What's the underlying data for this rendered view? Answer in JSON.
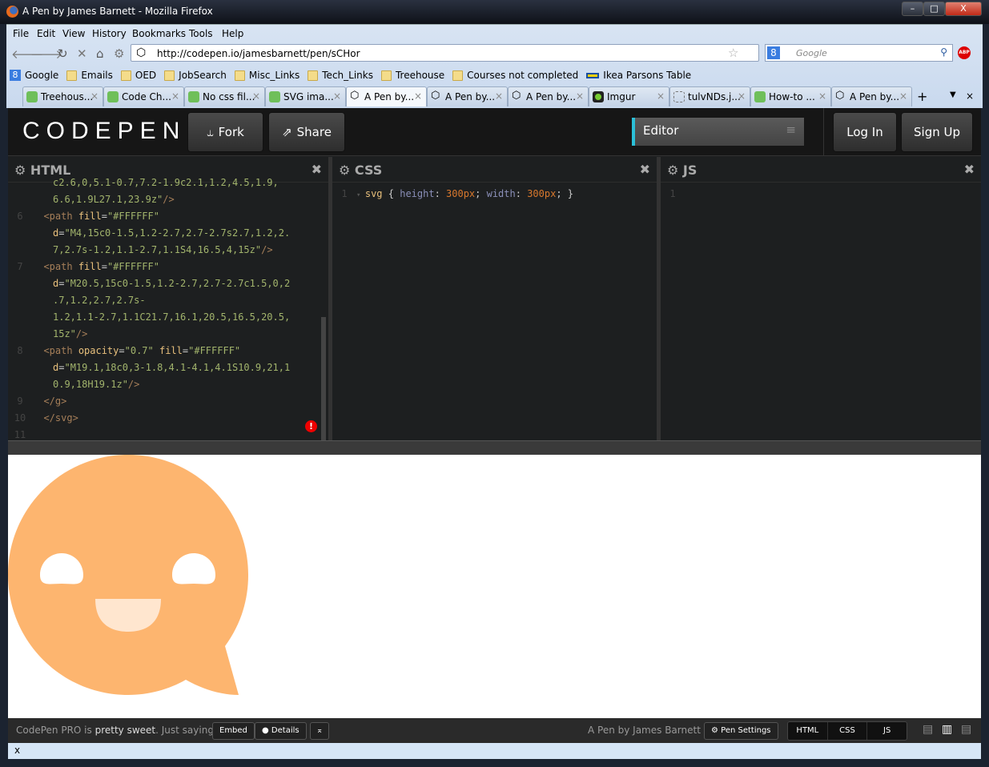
{
  "window": {
    "title": "A Pen by James Barnett - Mozilla Firefox",
    "controls": [
      "–",
      "□",
      "X"
    ]
  },
  "menu": [
    "File",
    "Edit",
    "View",
    "History",
    "Bookmarks",
    "Tools",
    "Help"
  ],
  "address": {
    "url": "http://codepen.io/jamesbarnett/pen/sCHor"
  },
  "search": {
    "placeholder": "Google"
  },
  "bookmarks": [
    "Google",
    "Emails",
    "OED",
    "JobSearch",
    "Misc_Links",
    "Tech_Links",
    "Treehouse",
    "Courses not completed",
    "Ikea Parsons Table"
  ],
  "tabs": [
    {
      "label": "Treehous...",
      "icon": "treehouse"
    },
    {
      "label": "Code Ch...",
      "icon": "treehouse"
    },
    {
      "label": "No css fil...",
      "icon": "treehouse"
    },
    {
      "label": "SVG ima...",
      "icon": "treehouse"
    },
    {
      "label": "A Pen by...",
      "icon": "codepen",
      "active": true
    },
    {
      "label": "A Pen by...",
      "icon": "codepen"
    },
    {
      "label": "A Pen by...",
      "icon": "codepen"
    },
    {
      "label": "Imgur",
      "icon": "imgur"
    },
    {
      "label": "tulvNDs.j...",
      "icon": "image"
    },
    {
      "label": "How-to ...",
      "icon": "treehouse"
    },
    {
      "label": "A Pen by...",
      "icon": "codepen"
    }
  ],
  "codepen": {
    "logo": "CODEPEN",
    "fork": "Fork",
    "share": "Share",
    "editor": "Editor",
    "login": "Log In",
    "signup": "Sign Up",
    "accent": "#2bc0d8"
  },
  "panels": {
    "html": "HTML",
    "css": "CSS",
    "js": "JS"
  },
  "html_code": [
    {
      "n": "",
      "cont": true,
      "t": [
        [
          "st",
          "c2.6,0,5.1-0.7,7.2-1.9c2.1,1.2,4.5,1.9,"
        ]
      ]
    },
    {
      "n": "",
      "cont": true,
      "t": [
        [
          "st",
          "6.6,1.9L27.1,23.9z\""
        ],
        [
          "tg",
          "/>"
        ]
      ]
    },
    {
      "n": "6",
      "t": [
        [
          "tg",
          "<path "
        ],
        [
          "at",
          "fill"
        ],
        [
          "",
          "="
        ],
        [
          "st",
          "\"#FFFFFF\""
        ]
      ]
    },
    {
      "n": "",
      "cont": true,
      "t": [
        [
          "at",
          "d"
        ],
        [
          "",
          "="
        ],
        [
          "st",
          "\"M4,15c0-1.5,1.2-2.7,2.7-2.7s2.7,1.2,2."
        ]
      ]
    },
    {
      "n": "",
      "cont": true,
      "t": [
        [
          "st",
          "7,2.7s-1.2,1.1-2.7,1.1S4,16.5,4,15z\""
        ],
        [
          "tg",
          "/>"
        ]
      ]
    },
    {
      "n": "7",
      "t": [
        [
          "tg",
          "<path "
        ],
        [
          "at",
          "fill"
        ],
        [
          "",
          "="
        ],
        [
          "st",
          "\"#FFFFFF\""
        ]
      ]
    },
    {
      "n": "",
      "cont": true,
      "t": [
        [
          "at",
          "d"
        ],
        [
          "",
          "="
        ],
        [
          "st",
          "\"M20.5,15c0-1.5,1.2-2.7,2.7-2.7c1.5,0,2"
        ]
      ]
    },
    {
      "n": "",
      "cont": true,
      "t": [
        [
          "st",
          ".7,1.2,2.7,2.7s-"
        ]
      ]
    },
    {
      "n": "",
      "cont": true,
      "t": [
        [
          "st",
          "1.2,1.1-2.7,1.1C21.7,16.1,20.5,16.5,20.5,"
        ]
      ]
    },
    {
      "n": "",
      "cont": true,
      "t": [
        [
          "st",
          "15z\""
        ],
        [
          "tg",
          "/>"
        ]
      ]
    },
    {
      "n": "8",
      "t": [
        [
          "tg",
          "<path "
        ],
        [
          "at",
          "opacity"
        ],
        [
          "",
          "="
        ],
        [
          "st",
          "\"0.7\" "
        ],
        [
          "at",
          "fill"
        ],
        [
          "",
          "="
        ],
        [
          "st",
          "\"#FFFFFF\""
        ]
      ]
    },
    {
      "n": "",
      "cont": true,
      "t": [
        [
          "at",
          "d"
        ],
        [
          "",
          "="
        ],
        [
          "st",
          "\"M19.1,18c0,3-1.8,4.1-4.1,4.1S10.9,21,1"
        ]
      ]
    },
    {
      "n": "",
      "cont": true,
      "t": [
        [
          "st",
          "0.9,18H19.1z\""
        ],
        [
          "tg",
          "/>"
        ]
      ]
    },
    {
      "n": "9",
      "t": [
        [
          "tg",
          "</g>"
        ]
      ]
    },
    {
      "n": "10",
      "t": [
        [
          "tg",
          "</svg>"
        ]
      ]
    },
    {
      "n": "11",
      "t": []
    }
  ],
  "css_code": [
    {
      "n": "1",
      "t": [
        [
          "at",
          "svg"
        ],
        [
          "",
          " { "
        ],
        [
          "pr",
          "height"
        ],
        [
          "",
          ": "
        ],
        [
          "nu",
          "300px"
        ],
        [
          "",
          "; "
        ],
        [
          "pr",
          "width"
        ],
        [
          "",
          ": "
        ],
        [
          "nu",
          "300px"
        ],
        [
          "",
          "; }"
        ]
      ]
    }
  ],
  "js_code": [
    {
      "n": "1",
      "t": []
    }
  ],
  "preview": {
    "bubble_color": "#FDB56F",
    "eye_color": "#FFFFFF",
    "mouth_color": "#FFE6CF"
  },
  "footer": {
    "promo_a": "CodePen PRO is ",
    "promo_b": "pretty sweet",
    "promo_c": ". Just saying.",
    "embed": "Embed",
    "details": "Details",
    "author": "A Pen by James Barnett",
    "settings": "Pen Settings",
    "views": [
      "HTML",
      "CSS",
      "JS"
    ]
  },
  "findbar": {
    "close": "x"
  }
}
